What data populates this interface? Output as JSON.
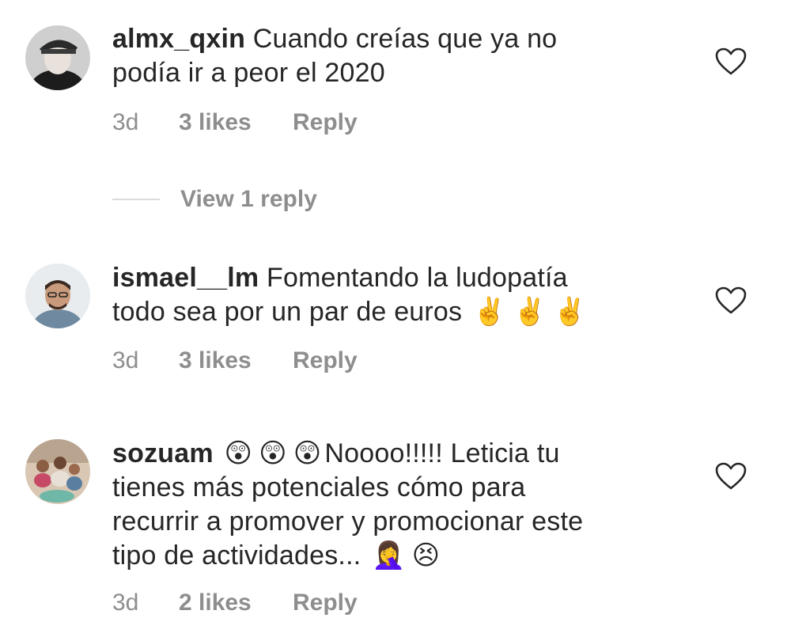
{
  "comments": [
    {
      "username": "almx_qxin",
      "text_line1": "Cuando creías que ya no",
      "text_line2": "podía ir a peor el 2020",
      "time": "3d",
      "likes": "3 likes",
      "reply": "Reply",
      "view_replies": "View 1 reply"
    },
    {
      "username": "ismael__lm",
      "text_line1": "Fomentando la ludopatía",
      "text_line2": "todo sea por un par de euros",
      "emoji_1": "✌️",
      "emoji_2": "✌️",
      "emoji_3": "✌️",
      "time": "3d",
      "likes": "3 likes",
      "reply": "Reply"
    },
    {
      "username": "sozuam",
      "emoji_1": "😲",
      "emoji_2": "😲",
      "emoji_3": "😲",
      "text_line1": "Noooo!!!!! Leticia tu",
      "text_line2": "tienes más potenciales cómo para",
      "text_line3": "recurrir a promover y promocionar este",
      "text_line4": "tipo de actividades...",
      "emoji_4": "🤦‍♀️",
      "emoji_5": "😣",
      "time": "3d",
      "likes": "2 likes",
      "reply": "Reply"
    }
  ],
  "colors": {
    "text": "#262626",
    "secondary": "#8e8e8e",
    "divider": "#dbdbdb",
    "background": "#ffffff"
  },
  "icons": {
    "like": "heart-outline-icon"
  }
}
